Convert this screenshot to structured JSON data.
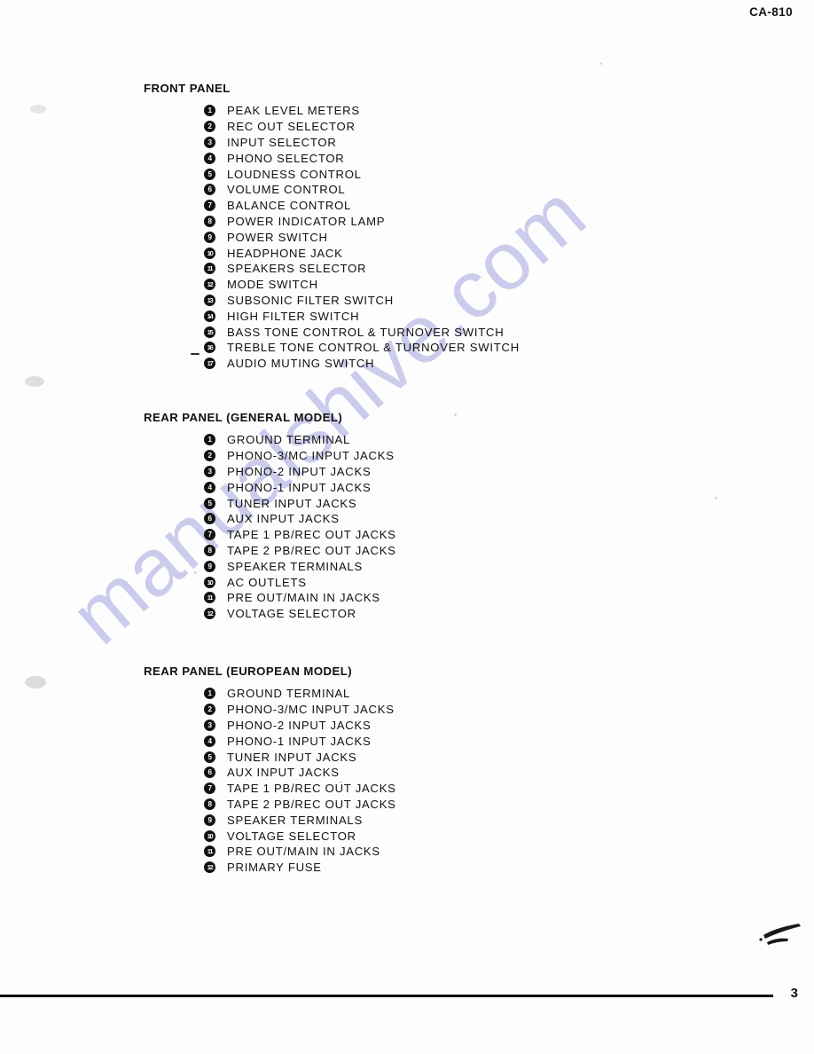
{
  "document": {
    "running_head": "CA-810",
    "page_number": "3",
    "watermark": "manualshive.com",
    "watermark_color": "#c9c9ec",
    "paper_color": "#fdfdfd",
    "ink_color": "#111111"
  },
  "sections": [
    {
      "title": "FRONT PANEL",
      "items": [
        {
          "num": "1",
          "label": "PEAK LEVEL METERS"
        },
        {
          "num": "2",
          "label": "REC OUT SELECTOR"
        },
        {
          "num": "3",
          "label": "INPUT SELECTOR"
        },
        {
          "num": "4",
          "label": "PHONO SELECTOR"
        },
        {
          "num": "5",
          "label": "LOUDNESS CONTROL"
        },
        {
          "num": "6",
          "label": "VOLUME CONTROL"
        },
        {
          "num": "7",
          "label": "BALANCE CONTROL"
        },
        {
          "num": "8",
          "label": "POWER INDICATOR LAMP"
        },
        {
          "num": "9",
          "label": "POWER SWITCH"
        },
        {
          "num": "10",
          "label": "HEADPHONE JACK"
        },
        {
          "num": "11",
          "label": "SPEAKERS SELECTOR"
        },
        {
          "num": "12",
          "label": "MODE SWITCH"
        },
        {
          "num": "13",
          "label": "SUBSONIC FILTER SWITCH"
        },
        {
          "num": "14",
          "label": "HIGH FILTER SWITCH"
        },
        {
          "num": "15",
          "label": "BASS TONE CONTROL & TURNOVER SWITCH"
        },
        {
          "num": "16",
          "label": "TREBLE TONE CONTROL & TURNOVER SWITCH"
        },
        {
          "num": "17",
          "label": "AUDIO MUTING SWITCH"
        }
      ]
    },
    {
      "title": "REAR PANEL (GENERAL MODEL)",
      "items": [
        {
          "num": "1",
          "label": "GROUND TERMINAL"
        },
        {
          "num": "2",
          "label": "PHONO-3/MC INPUT JACKS"
        },
        {
          "num": "3",
          "label": "PHONO-2 INPUT JACKS"
        },
        {
          "num": "4",
          "label": "PHONO-1 INPUT JACKS"
        },
        {
          "num": "5",
          "label": "TUNER INPUT JACKS"
        },
        {
          "num": "6",
          "label": "AUX INPUT JACKS"
        },
        {
          "num": "7",
          "label": "TAPE 1 PB/REC OUT JACKS"
        },
        {
          "num": "8",
          "label": "TAPE 2 PB/REC OUT JACKS"
        },
        {
          "num": "9",
          "label": "SPEAKER TERMINALS"
        },
        {
          "num": "10",
          "label": "AC OUTLETS"
        },
        {
          "num": "11",
          "label": "PRE OUT/MAIN IN JACKS"
        },
        {
          "num": "12",
          "label": "VOLTAGE SELECTOR"
        }
      ]
    },
    {
      "title": "REAR PANEL (EUROPEAN MODEL)",
      "items": [
        {
          "num": "1",
          "label": "GROUND TERMINAL"
        },
        {
          "num": "2",
          "label": "PHONO-3/MC INPUT JACKS"
        },
        {
          "num": "3",
          "label": "PHONO-2 INPUT JACKS"
        },
        {
          "num": "4",
          "label": "PHONO-1 INPUT JACKS"
        },
        {
          "num": "5",
          "label": "TUNER INPUT JACKS"
        },
        {
          "num": "6",
          "label": "AUX INPUT JACKS"
        },
        {
          "num": "7",
          "label": "TAPE 1 PB/REC OUT JACKS"
        },
        {
          "num": "8",
          "label": "TAPE 2 PB/REC OUT JACKS"
        },
        {
          "num": "9",
          "label": "SPEAKER TERMINALS"
        },
        {
          "num": "10",
          "label": "VOLTAGE SELECTOR"
        },
        {
          "num": "11",
          "label": "PRE OUT/MAIN IN JACKS"
        },
        {
          "num": "12",
          "label": "PRIMARY FUSE"
        }
      ]
    }
  ]
}
